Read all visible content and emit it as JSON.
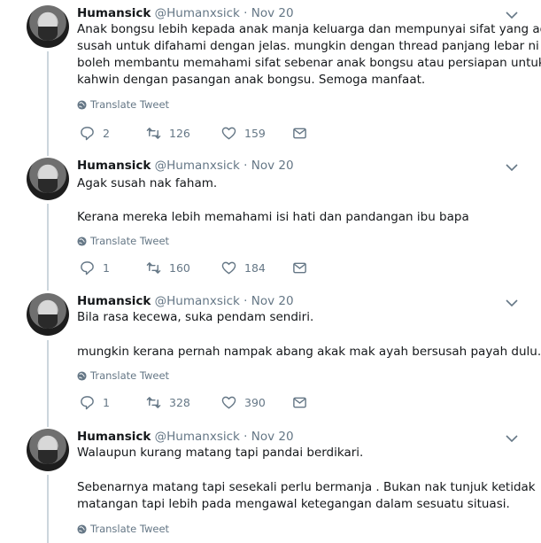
{
  "tweets": [
    {
      "name": "Humansick",
      "handle": "@Humanxsick",
      "dot": "·",
      "date": "Nov 20",
      "paragraphs": [
        [
          "Anak bongsu lebih kepada anak manja keluarga dan mempunyai sifat yang agak",
          "susah untuk difahami dengan jelas.  mungkin dengan thread panjang lebar ni",
          "boleh membantu memahami sifat sebenar anak bongsu atau persiapan untuk",
          "kahwin dengan pasangan anak bongsu. Semoga manfaat."
        ]
      ],
      "translate": "Translate Tweet",
      "replies": "2",
      "retweets": "126",
      "likes": "159"
    },
    {
      "name": "Humansick",
      "handle": "@Humanxsick",
      "dot": "·",
      "date": "Nov 20",
      "paragraphs": [
        [
          "Agak susah nak faham."
        ],
        [
          "Kerana mereka lebih memahami isi hati dan pandangan ibu bapa"
        ]
      ],
      "translate": "Translate Tweet",
      "replies": "1",
      "retweets": "160",
      "likes": "184"
    },
    {
      "name": "Humansick",
      "handle": "@Humanxsick",
      "dot": "·",
      "date": "Nov 20",
      "paragraphs": [
        [
          "Bila rasa kecewa, suka pendam sendiri."
        ],
        [
          "mungkin kerana pernah nampak abang akak mak ayah bersusah payah dulu."
        ]
      ],
      "translate": "Translate Tweet",
      "replies": "1",
      "retweets": "328",
      "likes": "390"
    },
    {
      "name": "Humansick",
      "handle": "@Humanxsick",
      "dot": "·",
      "date": "Nov 20",
      "paragraphs": [
        [
          "Walaupun kurang matang tapi pandai berdikari."
        ],
        [
          "Sebenarnya matang tapi sesekali perlu bermanja . Bukan nak tunjuk ketidak",
          "matangan tapi lebih pada mengawal ketegangan dalam sesuatu situasi."
        ]
      ],
      "translate": "Translate Tweet"
    }
  ]
}
